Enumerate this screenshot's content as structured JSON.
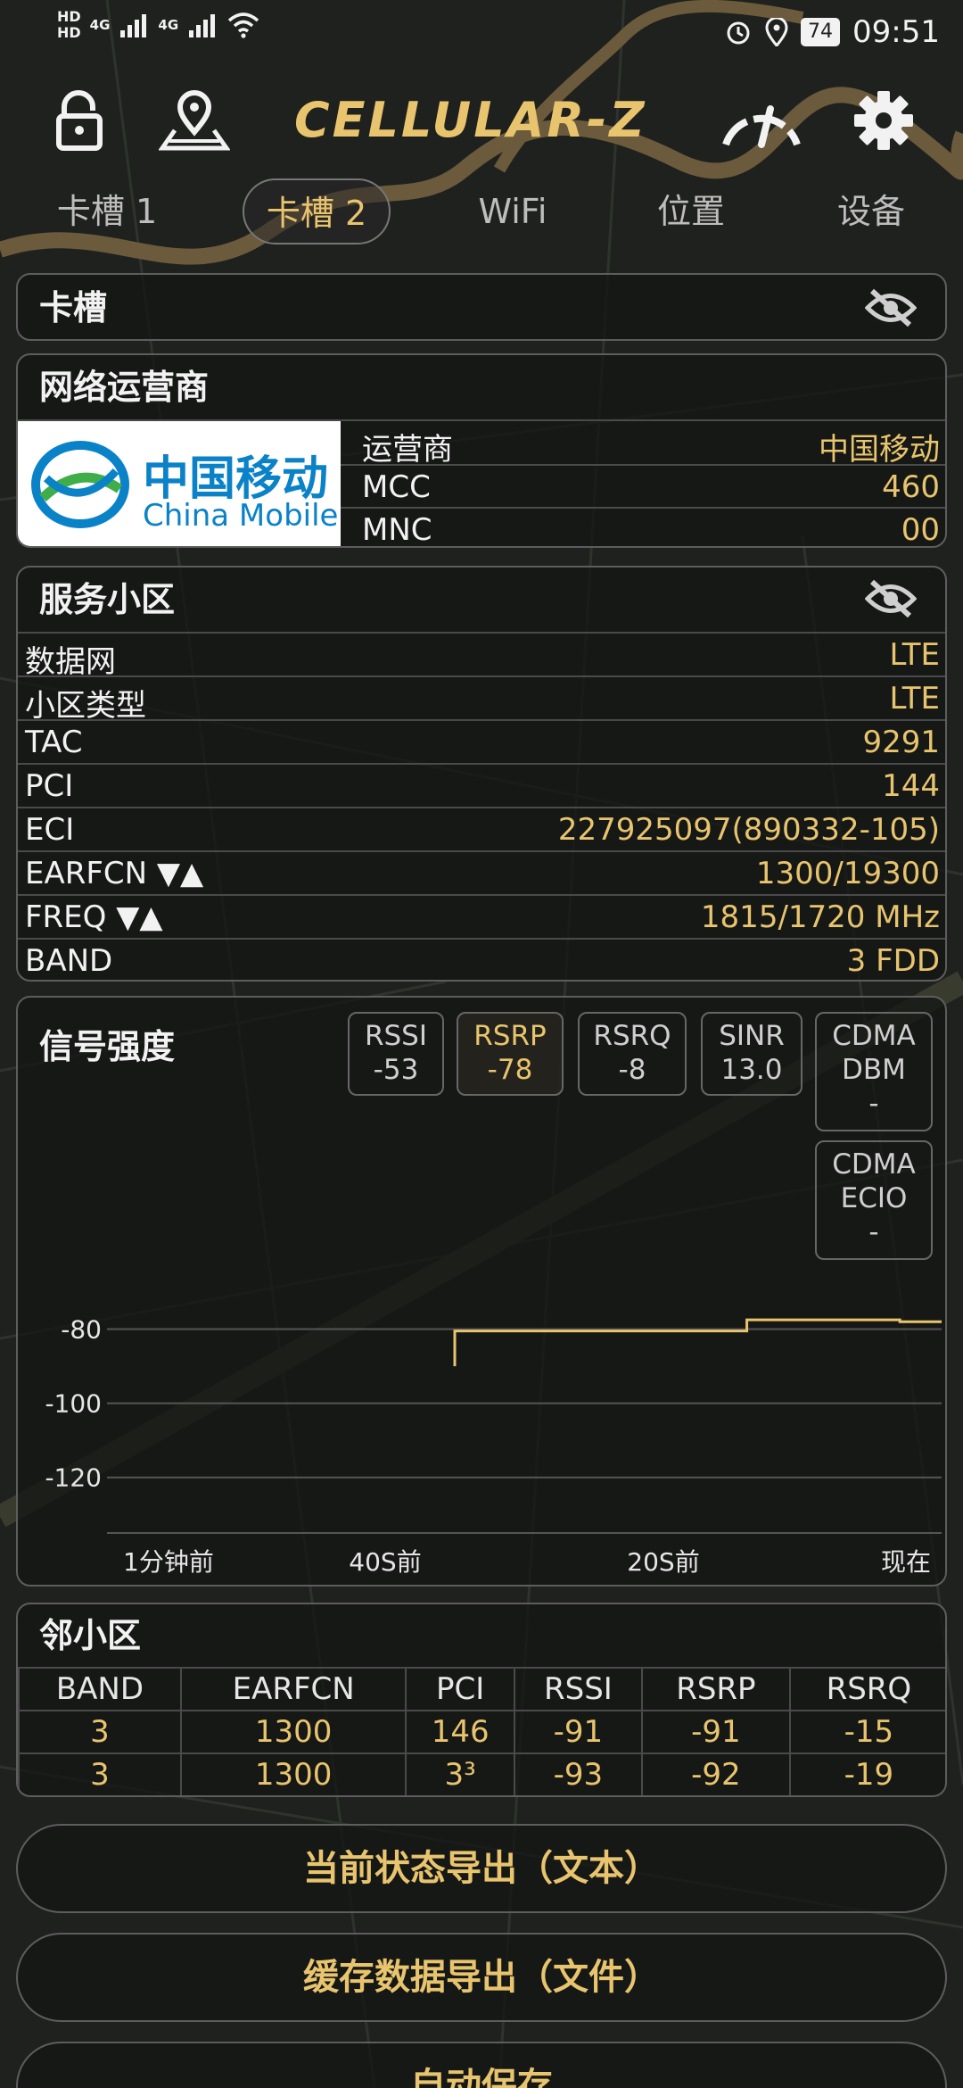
{
  "statusbar": {
    "signal_hd1": "HD",
    "signal_hd2": "HD",
    "network_1": "4G",
    "network_2": "4G",
    "battery": "74",
    "time": "09:51"
  },
  "toolbar": {
    "logo": "CELLULAR-Z",
    "lock_icon": "lock-icon",
    "location_icon": "location-pin-icon",
    "speedometer_icon": "speedometer-icon",
    "settings_icon": "gear-icon"
  },
  "tabs": [
    {
      "label": "卡槽 1",
      "active": false
    },
    {
      "label": "卡槽 2",
      "active": true
    },
    {
      "label": "WiFi",
      "active": false
    },
    {
      "label": "位置",
      "active": false
    },
    {
      "label": "设备",
      "active": false
    }
  ],
  "slot_panel": {
    "title": "卡槽"
  },
  "operator_panel": {
    "title": "网络运营商",
    "logo_cn": "中国移动",
    "logo_en": "China Mobile",
    "rows": [
      {
        "key": "运营商",
        "value": "中国移动"
      },
      {
        "key": "MCC",
        "value": "460"
      },
      {
        "key": "MNC",
        "value": "00"
      }
    ]
  },
  "serving_panel": {
    "title": "服务小区",
    "rows": [
      {
        "key": "数据网",
        "value": "LTE"
      },
      {
        "key": "小区类型",
        "value": "LTE"
      },
      {
        "key": "TAC",
        "value": "9291"
      },
      {
        "key": "PCI",
        "value": "144"
      },
      {
        "key": "ECI",
        "value": "227925097(890332-105)"
      },
      {
        "key": "EARFCN ▼▲",
        "value": "1300/19300"
      },
      {
        "key": "FREQ ▼▲",
        "value": "1815/1720 MHz"
      },
      {
        "key": "BAND",
        "value": "3 FDD"
      }
    ]
  },
  "signal_panel": {
    "title": "信号强度",
    "chips": [
      {
        "label": "RSSI",
        "value": "-53",
        "active": false
      },
      {
        "label": "RSRP",
        "value": "-78",
        "active": true
      },
      {
        "label": "RSRQ",
        "value": "-8",
        "active": false
      },
      {
        "label": "SINR",
        "value": "13.0",
        "active": false
      },
      {
        "label": "CDMA DBM",
        "value": "-",
        "active": false
      },
      {
        "label": "CDMA ECIO",
        "value": "-",
        "active": false
      }
    ]
  },
  "chart_data": {
    "type": "line",
    "title": "",
    "xlabel": "",
    "ylabel": "",
    "x_tick_labels": [
      "1分钟前",
      "40S前",
      "20S前",
      "现在"
    ],
    "y_ticks": [
      -80,
      -100,
      -120
    ],
    "ylim": [
      -135,
      -70
    ],
    "xlim": [
      -60,
      0
    ],
    "series": [
      {
        "color": "#e8c46e",
        "points": [
          [
            -35,
            -90
          ],
          [
            -35,
            -80.5
          ],
          [
            -14,
            -80.5
          ],
          [
            -14,
            -77.5
          ],
          [
            -3,
            -77.5
          ],
          [
            -3,
            -78
          ],
          [
            0,
            -78
          ]
        ]
      }
    ]
  },
  "neighbor_panel": {
    "title": "邻小区",
    "columns": [
      "BAND",
      "EARFCN",
      "PCI",
      "RSSI",
      "RSRP",
      "RSRQ"
    ],
    "rows": [
      [
        "3",
        "1300",
        "146",
        "-91",
        "-91",
        "-15"
      ],
      [
        "3",
        "1300",
        "3³",
        "-93",
        "-92",
        "-19"
      ]
    ]
  },
  "buttons": {
    "export_text": "当前状态导出（文本）",
    "export_file": "缓存数据导出（文件）",
    "auto_save": "自动保存"
  }
}
